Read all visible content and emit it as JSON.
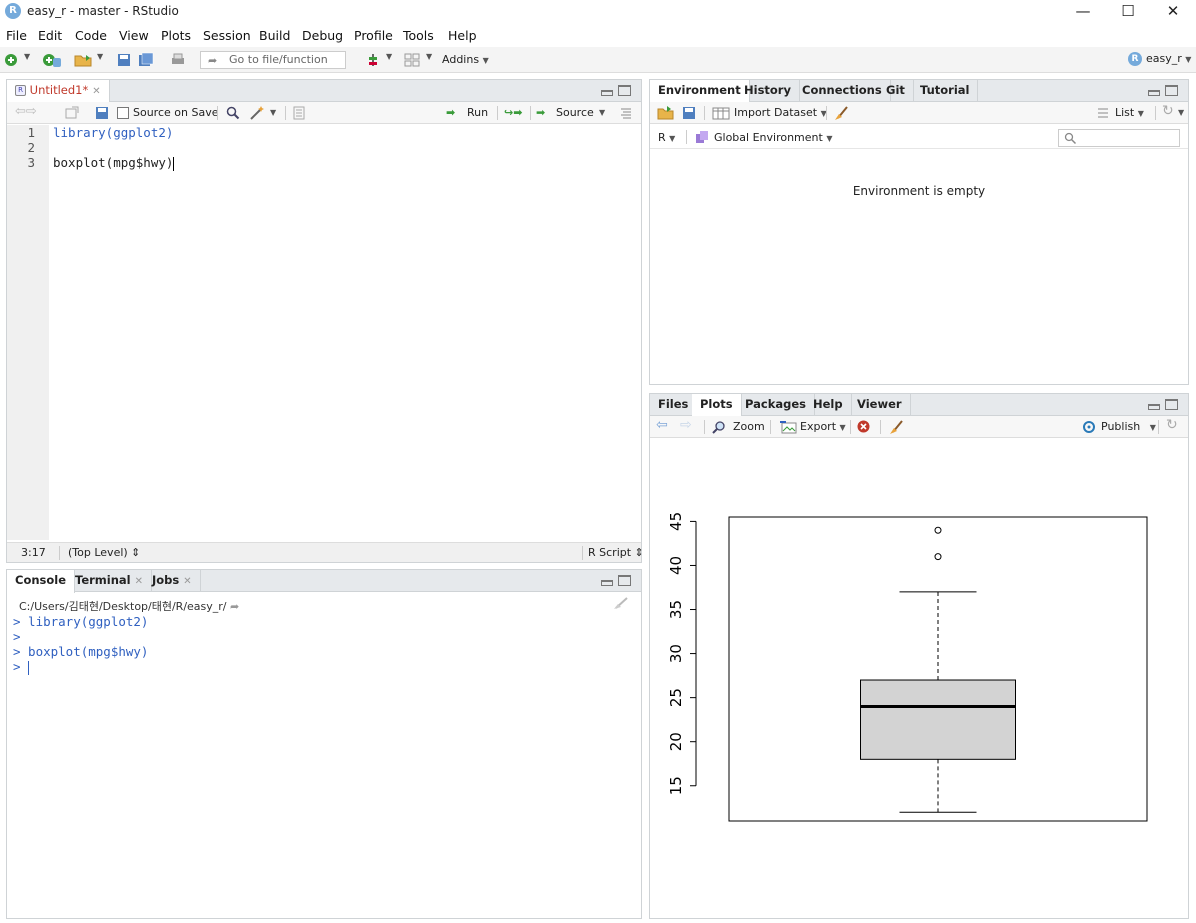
{
  "window": {
    "title": "easy_r - master - RStudio",
    "controls": [
      "minimize",
      "maximize",
      "close"
    ]
  },
  "menu": [
    "File",
    "Edit",
    "Code",
    "View",
    "Plots",
    "Session",
    "Build",
    "Debug",
    "Profile",
    "Tools",
    "Help"
  ],
  "toolbar": {
    "goto_placeholder": "Go to file/function",
    "addins": "Addins",
    "project": "easy_r"
  },
  "editor": {
    "tab": "Untitled1*",
    "source_on_save": "Source on Save",
    "run": "Run",
    "source": "Source",
    "lines": [
      {
        "num": "1",
        "code": "library(ggplot2)"
      },
      {
        "num": "2",
        "code": ""
      },
      {
        "num": "3",
        "code": "boxplot(mpg$hwy)"
      }
    ],
    "status": {
      "position": "3:17",
      "scope": "(Top Level)",
      "type": "R Script"
    }
  },
  "console": {
    "tabs": [
      "Console",
      "Terminal",
      "Jobs"
    ],
    "path": "C:/Users/김태현/Desktop/태현/R/easy_r/",
    "lines": [
      "> library(ggplot2)",
      ">",
      "> boxplot(mpg$hwy)",
      "> "
    ]
  },
  "environment": {
    "tabs": [
      "Environment",
      "History",
      "Connections",
      "Git",
      "Tutorial"
    ],
    "import_dataset": "Import Dataset",
    "list": "List",
    "lang": "R",
    "scope": "Global Environment",
    "empty_message": "Environment is empty"
  },
  "plots": {
    "tabs": [
      "Files",
      "Plots",
      "Packages",
      "Help",
      "Viewer"
    ],
    "zoom": "Zoom",
    "export": "Export",
    "publish": "Publish"
  },
  "chart_data": {
    "type": "boxplot",
    "title": "",
    "xlabel": "",
    "ylabel": "",
    "ylim": [
      11,
      45.5
    ],
    "yticks": [
      15,
      20,
      25,
      30,
      35,
      40,
      45
    ],
    "ytick_labels": [
      "15",
      "20",
      "25",
      "30",
      "35",
      "40",
      "45"
    ],
    "whisker_low": 12,
    "q1": 18,
    "median": 24,
    "q3": 27,
    "whisker_high": 37,
    "outliers": [
      41,
      44
    ],
    "box_fill": "#d3d3d3"
  },
  "colors": {
    "accent": "#3060c0",
    "r_logo": "#75aadb"
  }
}
